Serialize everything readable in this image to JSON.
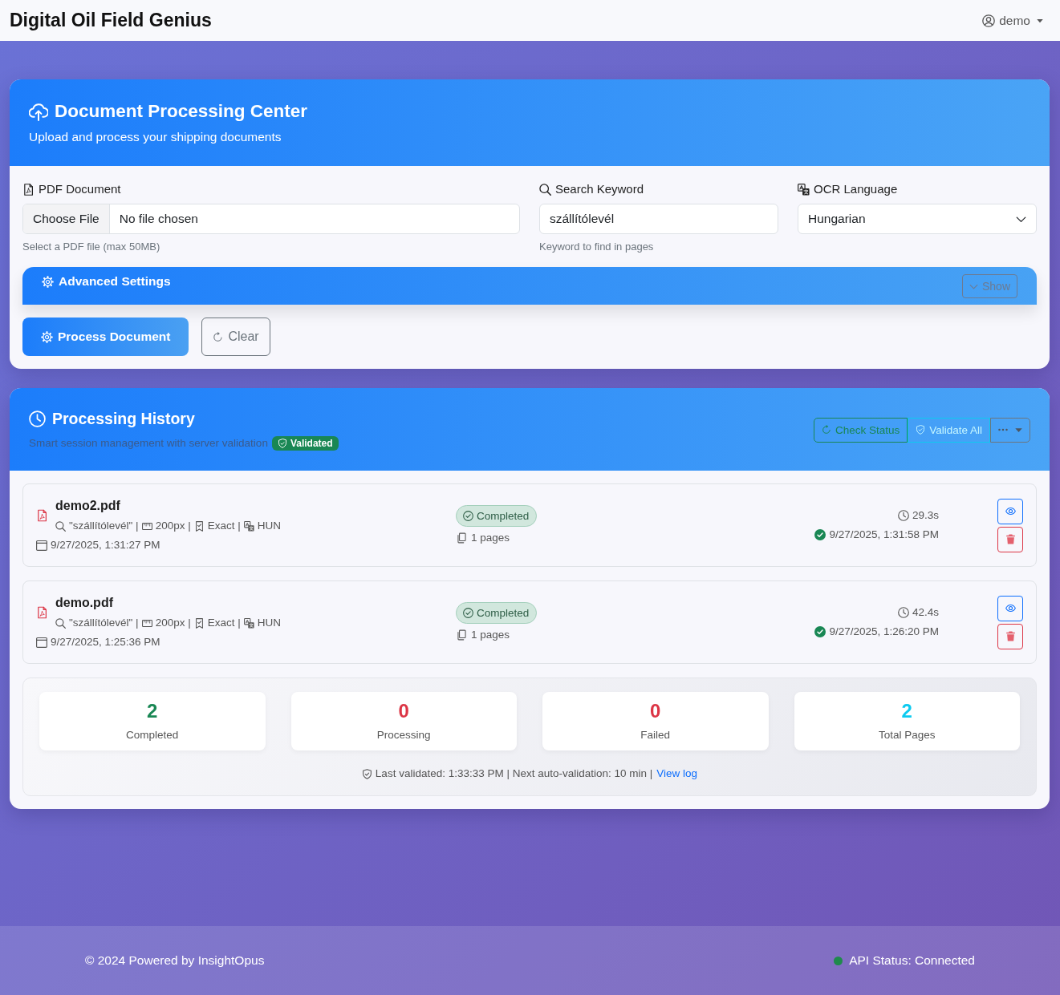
{
  "navbar": {
    "brand": "Digital Oil Field Genius",
    "user": "demo"
  },
  "upload_card": {
    "title": "Document Processing Center",
    "subtitle": "Upload and process your shipping documents",
    "fields": [
      {
        "kind": "file",
        "label": "PDF Document",
        "button": "Choose File",
        "value": "No file chosen",
        "help": "Select a PDF file (max 50MB)"
      },
      {
        "kind": "text",
        "label": "Search Keyword",
        "value": "szállítólevél",
        "help": "Keyword to find in pages"
      },
      {
        "kind": "select",
        "label": "OCR Language",
        "value": "Hungarian"
      }
    ],
    "advanced_settings": {
      "title": "Advanced Settings",
      "toggle": "Show",
      "expanded": false
    },
    "buttons": [
      {
        "kind": "primary",
        "label": "Process Document"
      },
      {
        "kind": "outline",
        "label": "Clear"
      }
    ]
  },
  "history_card": {
    "title": "Processing History",
    "subtitle": "Smart session management with server validation",
    "badge": "Validated",
    "actions": [
      {
        "kind": "success",
        "label": "Check Status"
      },
      {
        "kind": "info",
        "label": "Validate All"
      },
      {
        "kind": "more"
      }
    ],
    "items": [
      {
        "name": "demo2.pdf",
        "meta": [
          {
            "kind": "keyword",
            "text": "\"szállítólevél\" |"
          },
          {
            "kind": "resolution",
            "text": "200px |"
          },
          {
            "kind": "match",
            "text": "Exact |"
          },
          {
            "kind": "language",
            "text": "HUN"
          }
        ],
        "created": "9/27/2025, 1:31:27 PM",
        "status": {
          "kind": "completed",
          "label": "Completed"
        },
        "pages": "1 pages",
        "duration": "29.3s",
        "finished": "9/27/2025, 1:31:58 PM"
      },
      {
        "name": "demo.pdf",
        "meta": [
          {
            "kind": "keyword",
            "text": "\"szállítólevél\" |"
          },
          {
            "kind": "resolution",
            "text": "200px |"
          },
          {
            "kind": "match",
            "text": "Exact |"
          },
          {
            "kind": "language",
            "text": "HUN"
          }
        ],
        "created": "9/27/2025, 1:25:36 PM",
        "status": {
          "kind": "completed",
          "label": "Completed"
        },
        "pages": "1 pages",
        "duration": "42.4s",
        "finished": "9/27/2025, 1:26:20 PM"
      }
    ],
    "stats": [
      {
        "value": "2",
        "label": "Completed",
        "color": "#198754"
      },
      {
        "value": "0",
        "label": "Processing",
        "color": "#dc3545"
      },
      {
        "value": "0",
        "label": "Failed",
        "color": "#dc3545"
      },
      {
        "value": "2",
        "label": "Total Pages",
        "color": "#0dcaf0"
      }
    ],
    "validation": {
      "text": "Last validated: 1:33:33 PM | Next auto-validation: 10 min |",
      "link": "View log"
    }
  },
  "footer": {
    "copyright": "© 2024 Powered by InsightOpus",
    "api_status": "API Status: Connected",
    "connected": true
  }
}
